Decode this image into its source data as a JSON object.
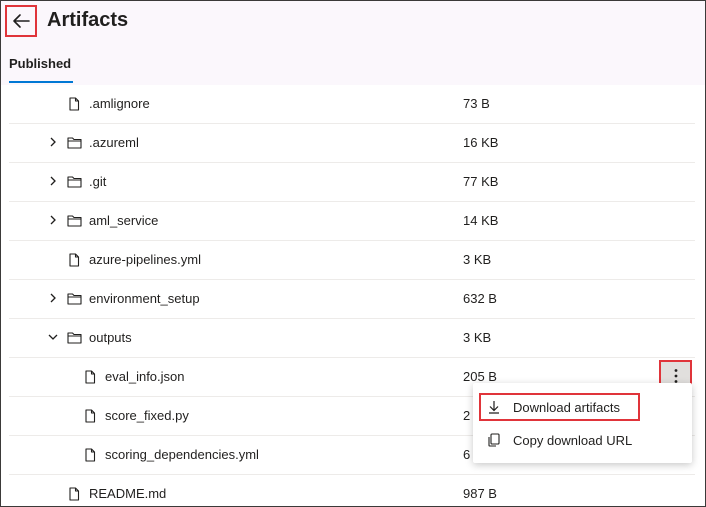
{
  "header": {
    "title": "Artifacts",
    "back_icon": "arrow-left-icon"
  },
  "tabs": [
    {
      "label": "Published",
      "selected": true
    }
  ],
  "files": [
    {
      "name": ".amlignore",
      "size": "73 B",
      "type": "file",
      "level": 0
    },
    {
      "name": ".azureml",
      "size": "16 KB",
      "type": "folder",
      "level": 0,
      "expanded": false
    },
    {
      "name": ".git",
      "size": "77 KB",
      "type": "folder",
      "level": 0,
      "expanded": false
    },
    {
      "name": "aml_service",
      "size": "14 KB",
      "type": "folder",
      "level": 0,
      "expanded": false
    },
    {
      "name": "azure-pipelines.yml",
      "size": "3 KB",
      "type": "file",
      "level": 0
    },
    {
      "name": "environment_setup",
      "size": "632 B",
      "type": "folder",
      "level": 0,
      "expanded": false
    },
    {
      "name": "outputs",
      "size": "3 KB",
      "type": "folder",
      "level": 0,
      "expanded": true
    },
    {
      "name": "eval_info.json",
      "size": "205 B",
      "type": "file",
      "level": 1
    },
    {
      "name": "score_fixed.py",
      "size": "2",
      "type": "file",
      "level": 1
    },
    {
      "name": "scoring_dependencies.yml",
      "size": "6",
      "type": "file",
      "level": 1
    },
    {
      "name": "README.md",
      "size": "987 B",
      "type": "file",
      "level": 0
    }
  ],
  "context_menu": {
    "items": [
      {
        "label": "Download artifacts",
        "icon": "download-icon"
      },
      {
        "label": "Copy download URL",
        "icon": "copy-icon"
      }
    ]
  },
  "colors": {
    "highlight": "#e0343a",
    "accent": "#0078d4",
    "header_bg": "#fbf7fc"
  }
}
